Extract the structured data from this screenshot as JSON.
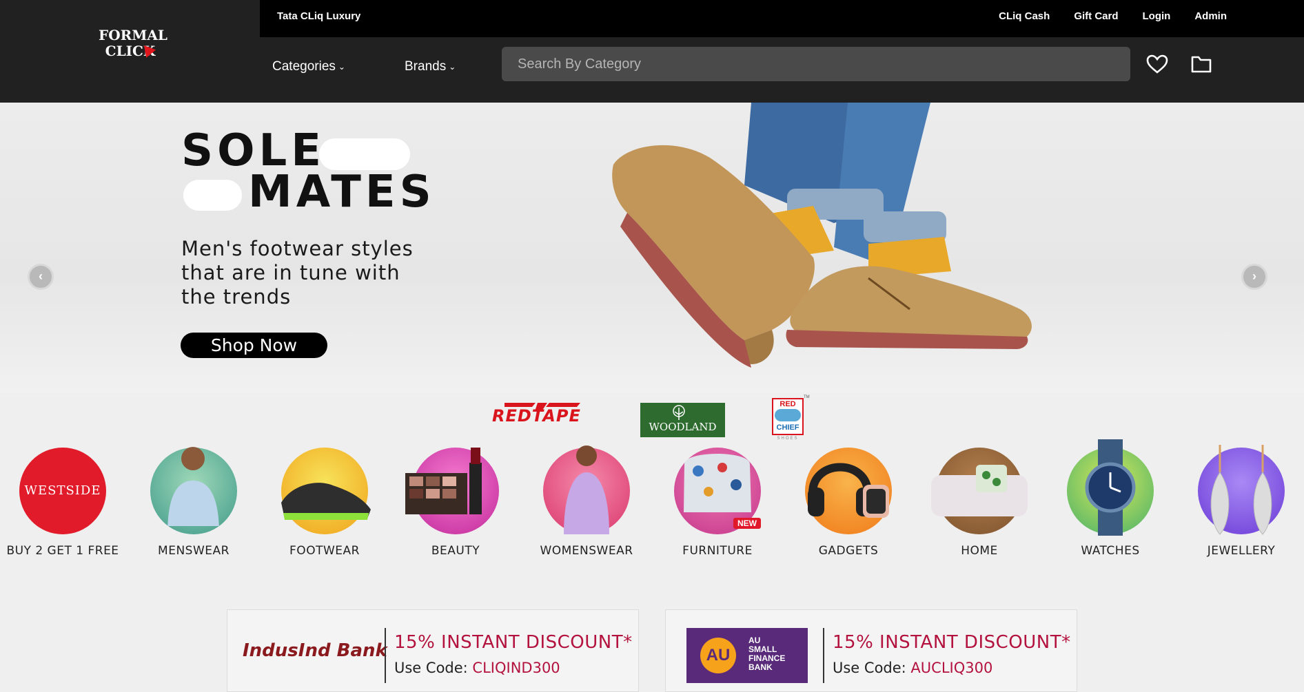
{
  "header": {
    "logo_line1": "FORMAL",
    "logo_line2": "CLICK",
    "luxury_link": "Tata CLiq Luxury",
    "top_links": [
      "CLiq Cash",
      "Gift Card",
      "Login",
      "Admin"
    ],
    "nav": {
      "categories": "Categories",
      "brands": "Brands"
    },
    "search_placeholder": "Search By Category"
  },
  "banner": {
    "headline_line1": "SOLE",
    "headline_line2": "MATES",
    "tagline_line1": "Men's footwear styles",
    "tagline_line2": "that are in tune with",
    "tagline_line3": "the trends",
    "cta": "Shop Now"
  },
  "brands": {
    "redtape": "REDTAPE",
    "woodland": "WOODLAND",
    "redchief_top": "RED",
    "redchief_bottom": "CHIEF",
    "redchief_sub": "SHOES",
    "tm": "TM"
  },
  "categories": [
    {
      "label": "BUY 2 GET 1 FREE",
      "logo": "WESTSIDE"
    },
    {
      "label": "MENSWEAR"
    },
    {
      "label": "FOOTWEAR"
    },
    {
      "label": "BEAUTY"
    },
    {
      "label": "WOMENSWEAR"
    },
    {
      "label": "FURNITURE",
      "badge": "NEW"
    },
    {
      "label": "GADGETS"
    },
    {
      "label": "HOME"
    },
    {
      "label": "WATCHES"
    },
    {
      "label": "JEWELLERY"
    }
  ],
  "offers": [
    {
      "bank": "IndusInd Bank",
      "discount": "15% INSTANT DISCOUNT*",
      "code_prefix": "Use Code: ",
      "code": "CLIQIND300"
    },
    {
      "bank_line1": "AU",
      "bank_line2": "AU",
      "bank_line3": "SMALL",
      "bank_line4": "FINANCE",
      "bank_line5": "BANK",
      "discount": "15% INSTANT DISCOUNT*",
      "code_prefix": "Use Code: ",
      "code": "AUCLIQ300"
    }
  ],
  "colors": {
    "header_bg": "#212121",
    "topbar_bg": "#000000",
    "accent_red": "#e1161c",
    "discount": "#b3123e"
  }
}
